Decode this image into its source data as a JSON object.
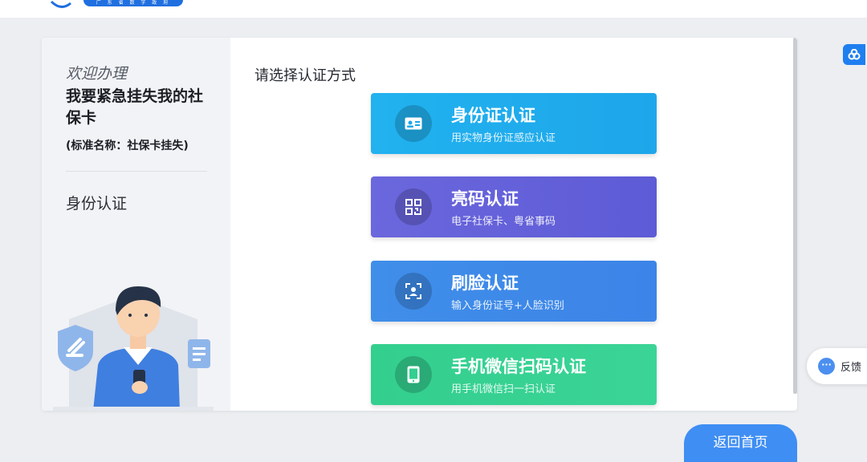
{
  "header": {
    "badge_text": "广 东 省 数 字 政 府"
  },
  "sidebar": {
    "welcome": "欢迎办理",
    "title": "我要紧急挂失我的社保卡",
    "standard_name": "(标准名称：社保卡挂失)",
    "current_step": "身份认证"
  },
  "main": {
    "prompt": "请选择认证方式",
    "options": [
      {
        "label": "身份证认证",
        "sub": "用实物身份证感应认证",
        "icon": "id-card-icon"
      },
      {
        "label": "亮码认证",
        "sub": "电子社保卡、粤省事码",
        "icon": "qr-code-icon"
      },
      {
        "label": "刷脸认证",
        "sub": "输入身份证号+人脸识别",
        "icon": "face-scan-icon"
      },
      {
        "label": "手机微信扫码认证",
        "sub": "用手机微信扫一扫认证",
        "icon": "phone-icon"
      }
    ]
  },
  "feedback": {
    "label": "反馈"
  },
  "footer": {
    "home_label": "返回首页"
  },
  "colors": {
    "id_card": "#21b2ef",
    "qr_code": "#6b67dd",
    "face": "#3f8ee9",
    "wechat": "#33cf8e",
    "primary": "#3f8ef3"
  }
}
